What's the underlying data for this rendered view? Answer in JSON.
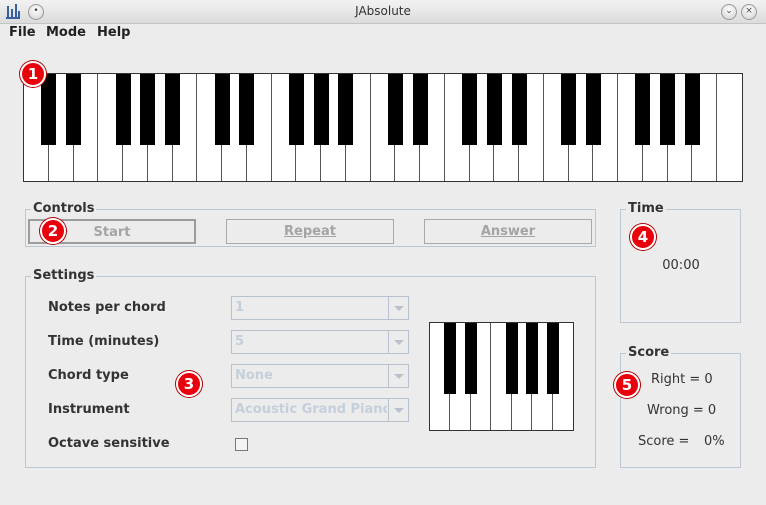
{
  "window": {
    "title": "JAbsolute"
  },
  "menu": {
    "items": [
      "File",
      "Mode",
      "Help"
    ]
  },
  "badges": [
    "1",
    "2",
    "3",
    "4",
    "5"
  ],
  "controls": {
    "title": "Controls",
    "start_label": "Start",
    "repeat_label": "Repeat",
    "answer_label": "Answer"
  },
  "settings": {
    "title": "Settings",
    "notes_per_chord_label": "Notes per chord",
    "notes_per_chord_value": "1",
    "time_label": "Time (minutes)",
    "time_value": "5",
    "chord_type_label": "Chord type",
    "chord_type_value": "None",
    "instrument_label": "Instrument",
    "instrument_value": "Acoustic Grand Piano",
    "octave_sensitive_label": "Octave sensitive",
    "octave_sensitive_checked": false
  },
  "time_panel": {
    "title": "Time",
    "value": "00:00"
  },
  "score_panel": {
    "title": "Score",
    "right": "Right = 0",
    "wrong": "Wrong = 0",
    "score_label": "Score =",
    "score_value": "0%"
  },
  "colors": {
    "badge": "#e8000a",
    "disabled_text": "#a4a4a4",
    "group_border": "#bcc7d3",
    "key_black": "#000000",
    "key_white": "#ffffff"
  }
}
